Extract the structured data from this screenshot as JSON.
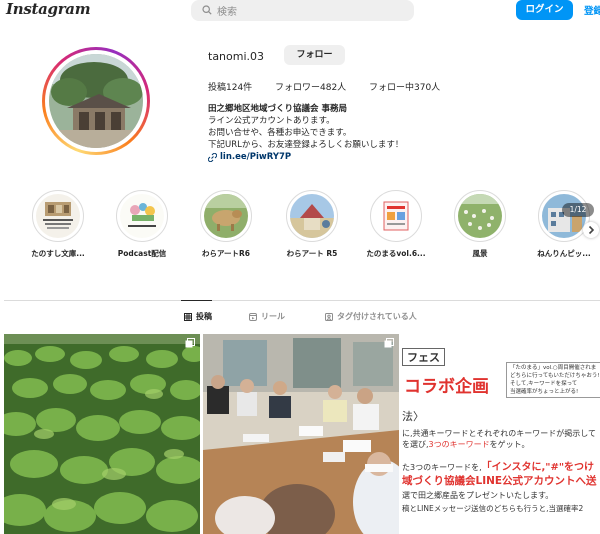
{
  "header": {
    "logo": "Instagram",
    "search_placeholder": "検索",
    "login_label": "ログイン",
    "signup_label": "登録"
  },
  "profile": {
    "username": "tanomi.03",
    "follow_label": "フォロー",
    "posts": "投稿124件",
    "followers": "フォロワー482人",
    "following": "フォロー中370人",
    "bio_name": "田之郷地区地域づくり協議会 事務局",
    "bio_lines": [
      "ライン公式アカウントあります。",
      "お問い合せや、各種お申込できます。",
      "下記URLから、お友達登録よろしくお願いします！"
    ],
    "link": "lin.ee/PiwRY7P"
  },
  "highlights": [
    {
      "label": "たのすし文庫..."
    },
    {
      "label": "Podcast配信"
    },
    {
      "label": "わらアートR6"
    },
    {
      "label": "わらアート R5"
    },
    {
      "label": "たのまるvol.6..."
    },
    {
      "label": "風景"
    },
    {
      "label": "ねんりんピッ..."
    }
  ],
  "highlight_counter": "1/12",
  "tabs": [
    {
      "label": "投稿",
      "icon": "grid-icon"
    },
    {
      "label": "リール",
      "icon": "reels-icon"
    },
    {
      "label": "タグ付けされている人",
      "icon": "tag-icon"
    }
  ],
  "posts": {
    "p3": {
      "fes": "フェス",
      "title": "コラボ企画",
      "howto": "法〉",
      "line1": "に,共通キーワードとそれぞれのキーワードが掲示して",
      "line2a": "を選び,",
      "line2b": "3つのキーワード",
      "line2c": "をゲット。",
      "line3a": "た3つのキーワードを,",
      "line3b": "「インスタに,\"#\"をつけ",
      "line4": "域づくり協議会LINE公式アカウントへ送",
      "line5": "選で田之郷産品をプレゼントいたします。",
      "line6": "稿とLINEメッセージ送信のどちらも行うと,当選確率2",
      "note1": "「たのまる」vol.○周目開催されま",
      "note2": "どちらに行ってもいただけちゃおう!",
      "note3": "そして,キーワードを探って",
      "note4": "当選確率がちょっと上がる!"
    }
  },
  "colors": {
    "accent": "#0095f6",
    "text": "#262626",
    "muted": "#8e8e8e",
    "red": "#e0332f"
  }
}
